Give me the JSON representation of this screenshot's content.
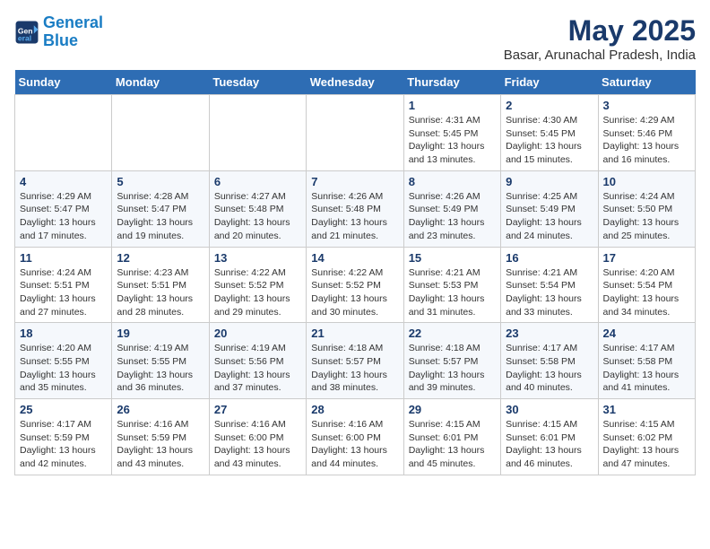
{
  "logo": {
    "line1": "General",
    "line2": "Blue"
  },
  "title": "May 2025",
  "subtitle": "Basar, Arunachal Pradesh, India",
  "weekdays": [
    "Sunday",
    "Monday",
    "Tuesday",
    "Wednesday",
    "Thursday",
    "Friday",
    "Saturday"
  ],
  "weeks": [
    [
      {
        "day": "",
        "info": ""
      },
      {
        "day": "",
        "info": ""
      },
      {
        "day": "",
        "info": ""
      },
      {
        "day": "",
        "info": ""
      },
      {
        "day": "1",
        "info": "Sunrise: 4:31 AM\nSunset: 5:45 PM\nDaylight: 13 hours\nand 13 minutes."
      },
      {
        "day": "2",
        "info": "Sunrise: 4:30 AM\nSunset: 5:45 PM\nDaylight: 13 hours\nand 15 minutes."
      },
      {
        "day": "3",
        "info": "Sunrise: 4:29 AM\nSunset: 5:46 PM\nDaylight: 13 hours\nand 16 minutes."
      }
    ],
    [
      {
        "day": "4",
        "info": "Sunrise: 4:29 AM\nSunset: 5:47 PM\nDaylight: 13 hours\nand 17 minutes."
      },
      {
        "day": "5",
        "info": "Sunrise: 4:28 AM\nSunset: 5:47 PM\nDaylight: 13 hours\nand 19 minutes."
      },
      {
        "day": "6",
        "info": "Sunrise: 4:27 AM\nSunset: 5:48 PM\nDaylight: 13 hours\nand 20 minutes."
      },
      {
        "day": "7",
        "info": "Sunrise: 4:26 AM\nSunset: 5:48 PM\nDaylight: 13 hours\nand 21 minutes."
      },
      {
        "day": "8",
        "info": "Sunrise: 4:26 AM\nSunset: 5:49 PM\nDaylight: 13 hours\nand 23 minutes."
      },
      {
        "day": "9",
        "info": "Sunrise: 4:25 AM\nSunset: 5:49 PM\nDaylight: 13 hours\nand 24 minutes."
      },
      {
        "day": "10",
        "info": "Sunrise: 4:24 AM\nSunset: 5:50 PM\nDaylight: 13 hours\nand 25 minutes."
      }
    ],
    [
      {
        "day": "11",
        "info": "Sunrise: 4:24 AM\nSunset: 5:51 PM\nDaylight: 13 hours\nand 27 minutes."
      },
      {
        "day": "12",
        "info": "Sunrise: 4:23 AM\nSunset: 5:51 PM\nDaylight: 13 hours\nand 28 minutes."
      },
      {
        "day": "13",
        "info": "Sunrise: 4:22 AM\nSunset: 5:52 PM\nDaylight: 13 hours\nand 29 minutes."
      },
      {
        "day": "14",
        "info": "Sunrise: 4:22 AM\nSunset: 5:52 PM\nDaylight: 13 hours\nand 30 minutes."
      },
      {
        "day": "15",
        "info": "Sunrise: 4:21 AM\nSunset: 5:53 PM\nDaylight: 13 hours\nand 31 minutes."
      },
      {
        "day": "16",
        "info": "Sunrise: 4:21 AM\nSunset: 5:54 PM\nDaylight: 13 hours\nand 33 minutes."
      },
      {
        "day": "17",
        "info": "Sunrise: 4:20 AM\nSunset: 5:54 PM\nDaylight: 13 hours\nand 34 minutes."
      }
    ],
    [
      {
        "day": "18",
        "info": "Sunrise: 4:20 AM\nSunset: 5:55 PM\nDaylight: 13 hours\nand 35 minutes."
      },
      {
        "day": "19",
        "info": "Sunrise: 4:19 AM\nSunset: 5:55 PM\nDaylight: 13 hours\nand 36 minutes."
      },
      {
        "day": "20",
        "info": "Sunrise: 4:19 AM\nSunset: 5:56 PM\nDaylight: 13 hours\nand 37 minutes."
      },
      {
        "day": "21",
        "info": "Sunrise: 4:18 AM\nSunset: 5:57 PM\nDaylight: 13 hours\nand 38 minutes."
      },
      {
        "day": "22",
        "info": "Sunrise: 4:18 AM\nSunset: 5:57 PM\nDaylight: 13 hours\nand 39 minutes."
      },
      {
        "day": "23",
        "info": "Sunrise: 4:17 AM\nSunset: 5:58 PM\nDaylight: 13 hours\nand 40 minutes."
      },
      {
        "day": "24",
        "info": "Sunrise: 4:17 AM\nSunset: 5:58 PM\nDaylight: 13 hours\nand 41 minutes."
      }
    ],
    [
      {
        "day": "25",
        "info": "Sunrise: 4:17 AM\nSunset: 5:59 PM\nDaylight: 13 hours\nand 42 minutes."
      },
      {
        "day": "26",
        "info": "Sunrise: 4:16 AM\nSunset: 5:59 PM\nDaylight: 13 hours\nand 43 minutes."
      },
      {
        "day": "27",
        "info": "Sunrise: 4:16 AM\nSunset: 6:00 PM\nDaylight: 13 hours\nand 43 minutes."
      },
      {
        "day": "28",
        "info": "Sunrise: 4:16 AM\nSunset: 6:00 PM\nDaylight: 13 hours\nand 44 minutes."
      },
      {
        "day": "29",
        "info": "Sunrise: 4:15 AM\nSunset: 6:01 PM\nDaylight: 13 hours\nand 45 minutes."
      },
      {
        "day": "30",
        "info": "Sunrise: 4:15 AM\nSunset: 6:01 PM\nDaylight: 13 hours\nand 46 minutes."
      },
      {
        "day": "31",
        "info": "Sunrise: 4:15 AM\nSunset: 6:02 PM\nDaylight: 13 hours\nand 47 minutes."
      }
    ]
  ]
}
